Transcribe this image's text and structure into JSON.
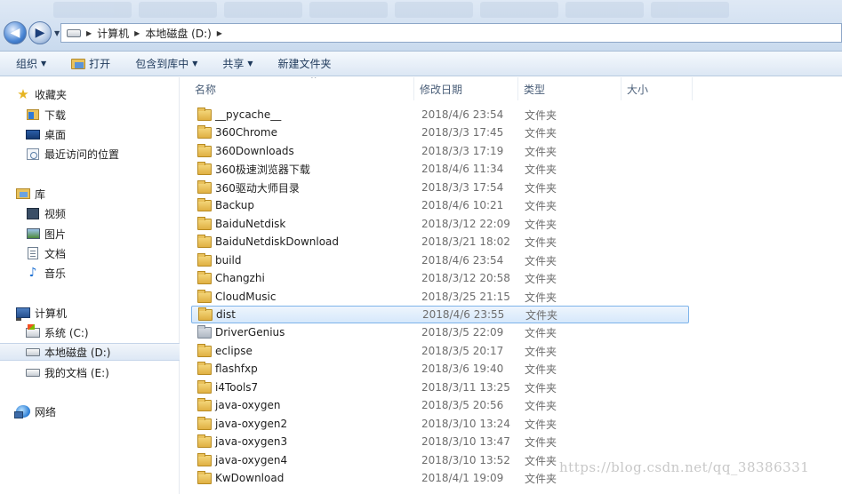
{
  "address": {
    "crumbs": [
      "计算机",
      "本地磁盘 (D:)"
    ]
  },
  "toolbar": {
    "organize": "组织",
    "open": "打开",
    "include_in_library": "包含到库中",
    "share": "共享",
    "new_folder": "新建文件夹"
  },
  "sidebar": {
    "favorites": "收藏夹",
    "downloads": "下载",
    "desktop": "桌面",
    "recent": "最近访问的位置",
    "libraries": "库",
    "videos": "视频",
    "pictures": "图片",
    "documents": "文档",
    "music": "音乐",
    "computer": "计算机",
    "system_c": "系统 (C:)",
    "local_d": "本地磁盘 (D:)",
    "mydocs_e": "我的文档 (E:)",
    "network": "网络"
  },
  "columns": {
    "name": "名称",
    "date": "修改日期",
    "type": "类型",
    "size": "大小"
  },
  "files": [
    {
      "name": "__pycache__",
      "date": "2018/4/6 23:54",
      "type": "文件夹"
    },
    {
      "name": "360Chrome",
      "date": "2018/3/3 17:45",
      "type": "文件夹"
    },
    {
      "name": "360Downloads",
      "date": "2018/3/3 17:19",
      "type": "文件夹"
    },
    {
      "name": "360极速浏览器下载",
      "date": "2018/4/6 11:34",
      "type": "文件夹"
    },
    {
      "name": "360驱动大师目录",
      "date": "2018/3/3 17:54",
      "type": "文件夹"
    },
    {
      "name": "Backup",
      "date": "2018/4/6 10:21",
      "type": "文件夹"
    },
    {
      "name": "BaiduNetdisk",
      "date": "2018/3/12 22:09",
      "type": "文件夹"
    },
    {
      "name": "BaiduNetdiskDownload",
      "date": "2018/3/21 18:02",
      "type": "文件夹"
    },
    {
      "name": "build",
      "date": "2018/4/6 23:54",
      "type": "文件夹"
    },
    {
      "name": "Changzhi",
      "date": "2018/3/12 20:58",
      "type": "文件夹"
    },
    {
      "name": "CloudMusic",
      "date": "2018/3/25 21:15",
      "type": "文件夹"
    },
    {
      "name": "dist",
      "date": "2018/4/6 23:55",
      "type": "文件夹"
    },
    {
      "name": "DriverGenius",
      "date": "2018/3/5 22:09",
      "type": "文件夹"
    },
    {
      "name": "eclipse",
      "date": "2018/3/5 20:17",
      "type": "文件夹"
    },
    {
      "name": "flashfxp",
      "date": "2018/3/6 19:40",
      "type": "文件夹"
    },
    {
      "name": "i4Tools7",
      "date": "2018/3/11 13:25",
      "type": "文件夹"
    },
    {
      "name": "java-oxygen",
      "date": "2018/3/5 20:56",
      "type": "文件夹"
    },
    {
      "name": "java-oxygen2",
      "date": "2018/3/10 13:24",
      "type": "文件夹"
    },
    {
      "name": "java-oxygen3",
      "date": "2018/3/10 13:47",
      "type": "文件夹"
    },
    {
      "name": "java-oxygen4",
      "date": "2018/3/10 13:52",
      "type": "文件夹"
    },
    {
      "name": "KwDownload",
      "date": "2018/4/1 19:09",
      "type": "文件夹"
    }
  ],
  "selected_file": "dist",
  "watermark": "https://blog.csdn.net/qq_38386331"
}
